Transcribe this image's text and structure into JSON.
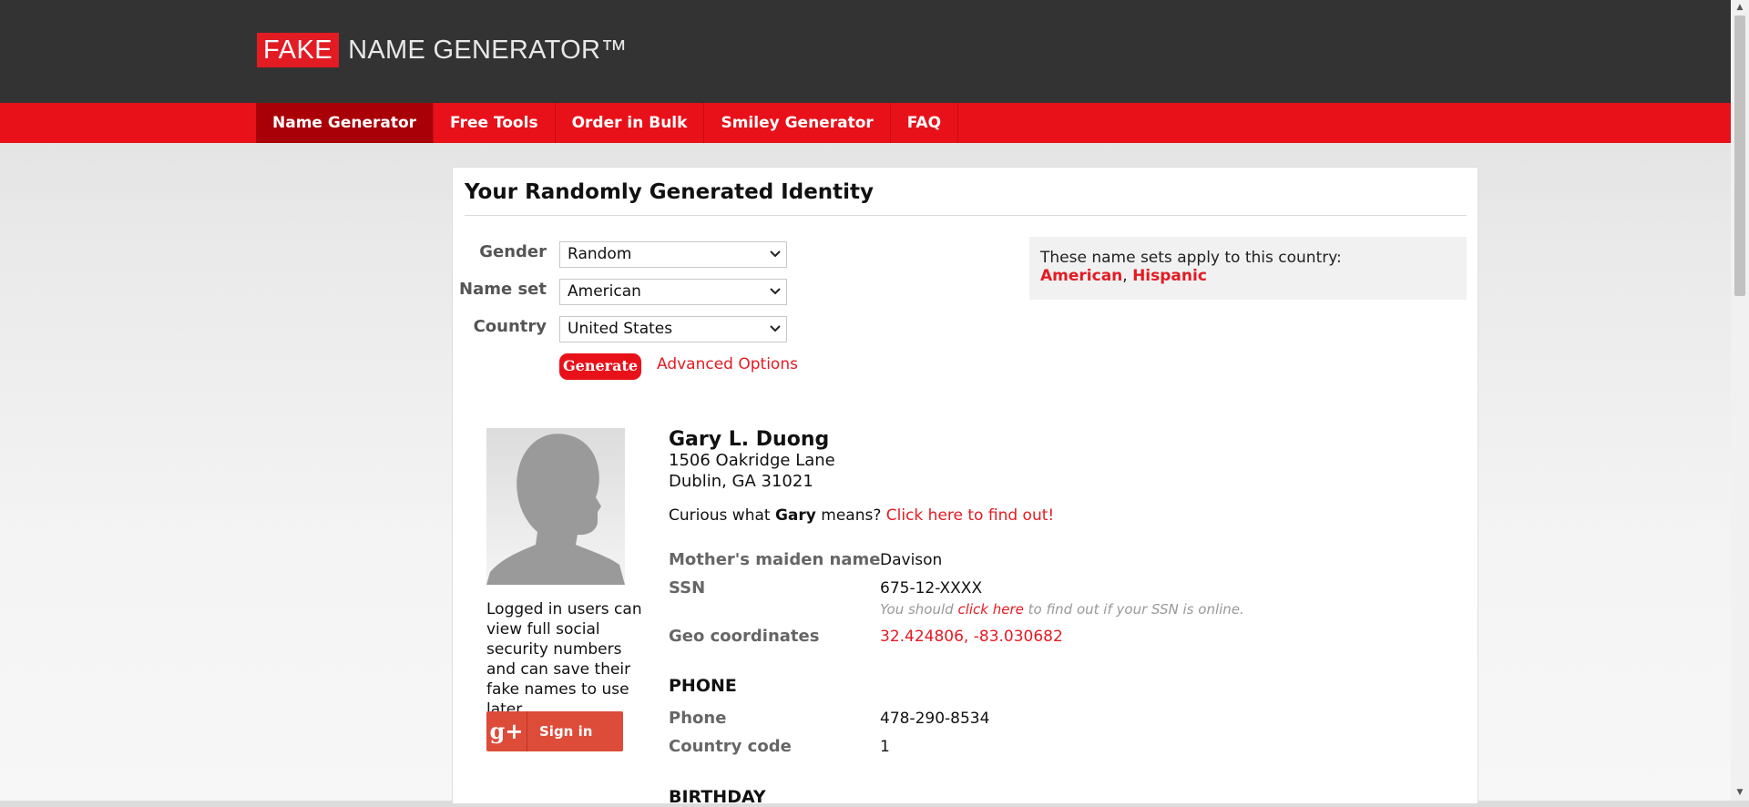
{
  "header": {
    "logo_fake": "FAKE",
    "logo_rest": "NAME GENERATOR™"
  },
  "nav": {
    "items": [
      {
        "label": "Name Generator"
      },
      {
        "label": "Free Tools"
      },
      {
        "label": "Order in Bulk"
      },
      {
        "label": "Smiley Generator"
      },
      {
        "label": "FAQ"
      }
    ],
    "active": "Name Generator"
  },
  "panel": {
    "title": "Your Randomly Generated Identity"
  },
  "form": {
    "gender_label": "Gender",
    "gender_value": "Random",
    "nameset_label": "Name set",
    "nameset_value": "American",
    "country_label": "Country",
    "country_value": "United States",
    "generate_label": "Generate",
    "advanced_label": "Advanced Options"
  },
  "namesets": {
    "intro": "These name sets apply to this country:",
    "link1": "American",
    "sep": ",",
    "link2": "Hispanic"
  },
  "sidebar": {
    "note": "Logged in users can view full social security numbers and can save their fake names to use later.",
    "signin_label": "Sign in",
    "gplus_glyph": "g+"
  },
  "identity": {
    "name": "Gary L. Duong",
    "street": "1506 Oakridge Lane",
    "city_line": "Dublin, GA 31021",
    "curious_prefix": "Curious what",
    "curious_name": "Gary",
    "curious_suffix": "means?",
    "curious_link": "Click here to find out!",
    "maiden_label": "Mother's maiden name",
    "maiden_value": "Davison",
    "ssn_label": "SSN",
    "ssn_value": "675-12-XXXX",
    "ssn_note_prefix": "You should",
    "ssn_note_link": "click here",
    "ssn_note_suffix": "to find out if your SSN is online.",
    "geo_label": "Geo coordinates",
    "geo_value": "32.424806, -83.030682",
    "phone_section": "PHONE",
    "phone_label": "Phone",
    "phone_value": "478-290-8534",
    "cc_label": "Country code",
    "cc_value": "1",
    "birthday_section": "BIRTHDAY"
  },
  "colors": {
    "brand_red": "#e31b23",
    "nav_red": "#e8111a",
    "active_nav": "#a90008",
    "header_dark": "#333333",
    "gplus_red": "#dd4b39"
  },
  "icons": {
    "select_arrow": "chevron-down-icon",
    "avatar": "person-silhouette-icon",
    "gplus": "google-plus-icon"
  }
}
